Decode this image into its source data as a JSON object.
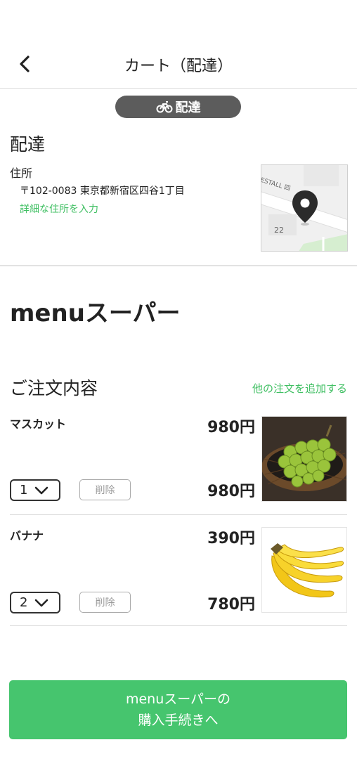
{
  "header": {
    "title": "カート（配達）"
  },
  "mode_pill": {
    "label": "配達",
    "icon": "bicycle-icon"
  },
  "delivery": {
    "title": "配達",
    "address_label": "住所",
    "address": "〒102-0083 東京都新宿区四谷1丁目",
    "detail_link": "詳細な住所を入力",
    "map_street_text": "ESTALL 四",
    "map_number": "22"
  },
  "store": {
    "name": "menuスーパー"
  },
  "order": {
    "title": "ご注文内容",
    "add_link": "他の注文を追加する",
    "items": [
      {
        "name": "マスカット",
        "unit_price": "980円",
        "qty": "1",
        "total_price": "980円",
        "delete_label": "削除",
        "image": "muscat-grapes"
      },
      {
        "name": "バナナ",
        "unit_price": "390円",
        "qty": "2",
        "total_price": "780円",
        "delete_label": "削除",
        "image": "bananas"
      }
    ]
  },
  "checkout": {
    "line1": "menuスーパーの",
    "line2": "購入手続きへ"
  },
  "colors": {
    "accent": "#46c56e",
    "link": "#3fbf62",
    "pill": "#5c5c5c"
  }
}
